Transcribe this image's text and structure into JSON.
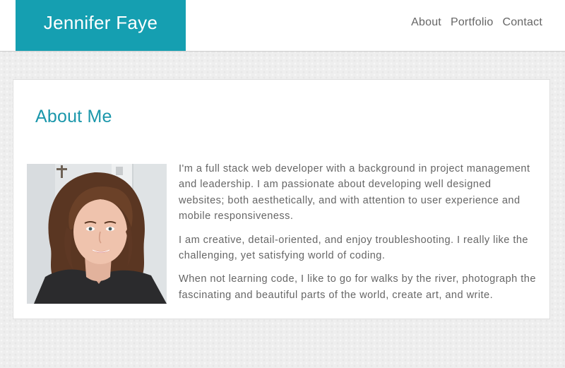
{
  "header": {
    "brand": "Jennifer Faye",
    "nav": [
      {
        "label": "About"
      },
      {
        "label": "Portfolio"
      },
      {
        "label": "Contact"
      }
    ]
  },
  "about": {
    "title": "About Me",
    "paragraphs": [
      "I'm a full stack web developer with a background in project management and leadership. I am passionate about developing well designed websites; both aesthetically, and with attention to user experience and mobile responsiveness.",
      "I am creative, detail-oriented, and enjoy troubleshooting. I really like the challenging, yet satisfying world of coding.",
      "When not learning code, I like to go for walks by the river, photograph the fascinating and beautiful parts of the world, create art, and write."
    ]
  },
  "colors": {
    "accent": "#159fb1",
    "heading": "#1b97ab",
    "text": "#666666",
    "background": "#eeeeee"
  }
}
